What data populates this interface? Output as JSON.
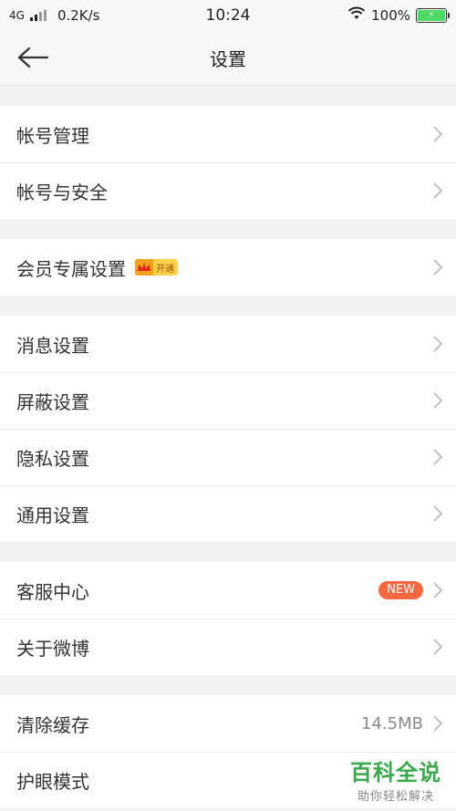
{
  "status_bar": {
    "network": "4G",
    "speed": "0.2K/s",
    "time": "10:24",
    "battery": "100%"
  },
  "nav": {
    "title": "设置"
  },
  "groups": [
    {
      "items": [
        {
          "label": "帐号管理"
        },
        {
          "label": "帐号与安全"
        }
      ]
    },
    {
      "items": [
        {
          "label": "会员专属设置",
          "badge": "开通"
        }
      ]
    },
    {
      "items": [
        {
          "label": "消息设置"
        },
        {
          "label": "屏蔽设置"
        },
        {
          "label": "隐私设置"
        },
        {
          "label": "通用设置"
        }
      ]
    },
    {
      "items": [
        {
          "label": "客服中心",
          "badge": "NEW"
        },
        {
          "label": "关于微博"
        }
      ]
    },
    {
      "items": [
        {
          "label": "清除缓存",
          "value": "14.5MB"
        },
        {
          "label": "护眼模式"
        }
      ]
    }
  ],
  "watermark": {
    "title": "百科全说",
    "subtitle": "助你轻松解决"
  },
  "colors": {
    "accent_badge": "#f4683f",
    "battery": "#4cd964",
    "watermark": "#3aa84c"
  }
}
